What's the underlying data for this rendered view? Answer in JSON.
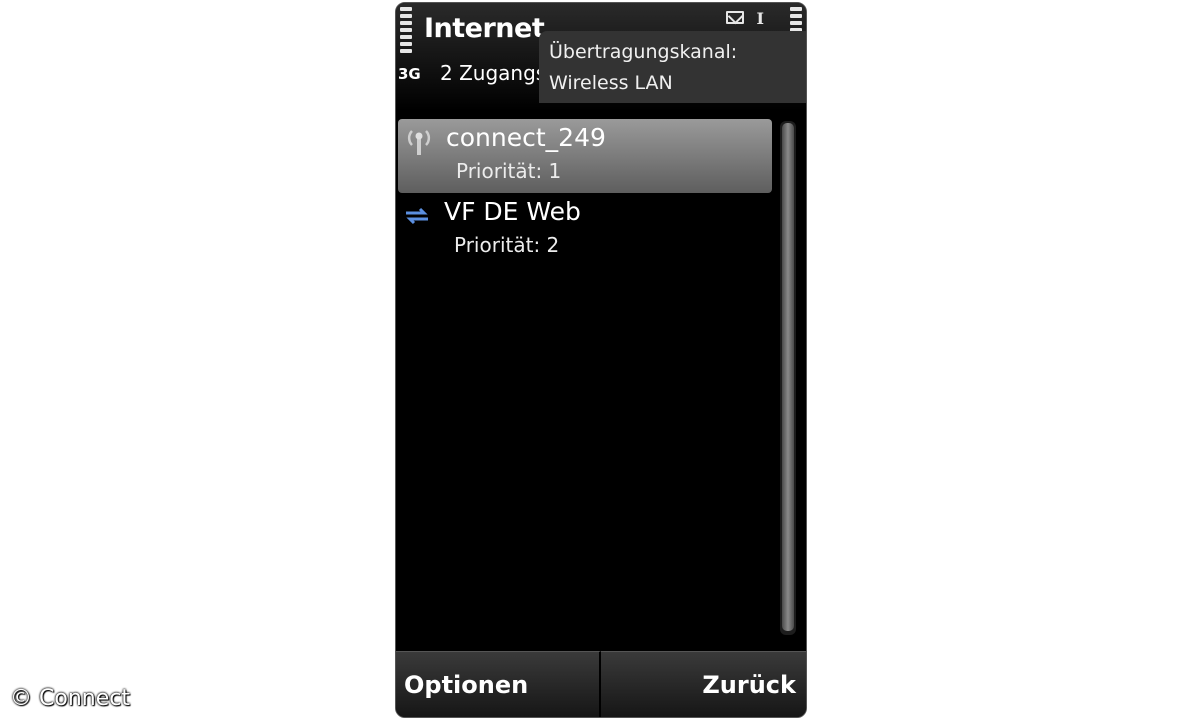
{
  "status_bar": {
    "app_title": "Internet",
    "net_type": "3G",
    "subtitle": "2 Zugangs",
    "icons": [
      "signal-strength-icon",
      "mail-icon",
      "text-input-icon",
      "battery-icon"
    ]
  },
  "tooltip": {
    "line1": "Übertragungskanal:",
    "line2": "Wireless LAN"
  },
  "list": {
    "items": [
      {
        "title": "connect_249",
        "subtitle": "Priorität: 1",
        "icon": "wlan-antenna-icon",
        "selected": true
      },
      {
        "title": "VF DE Web",
        "subtitle": "Priorität: 2",
        "icon": "packet-data-icon",
        "selected": false
      }
    ]
  },
  "softkeys": {
    "left": "Optionen",
    "right": "Zurück"
  },
  "watermark": "© Connect",
  "colors": {
    "background": "#000000",
    "selection": "#7a7a7a",
    "text": "#ffffff"
  }
}
